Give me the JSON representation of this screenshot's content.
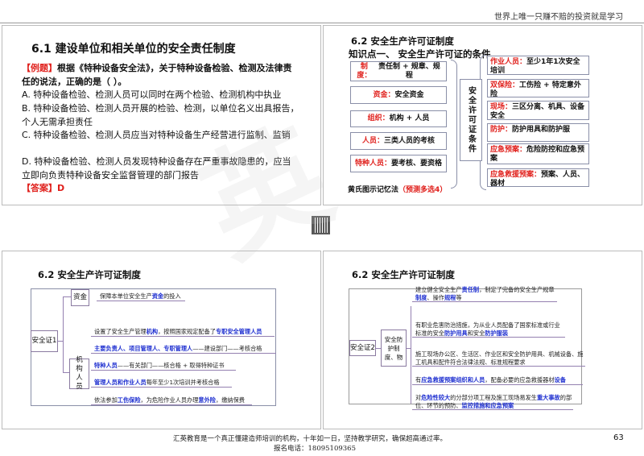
{
  "header": {
    "motto": "世界上唯一只赚不赔的投资就是学习"
  },
  "slide1": {
    "title": "6.1 建设单位和相关单位的安全责任制度",
    "question_tag": "【例题】",
    "question": "根据《特种设备安全法》，关于特种设备检验、检测及法律责任的说法，正确的是（ ）。",
    "options": [
      "A. 特种设备检验、检测人员可以同时在两个检验、检测机构中执业",
      "B. 特种设备检验、检测人员开展的检验、检测，以单位名义出具报告，个人无需承担责任",
      "C. 特种设备检验、检测人员应当对特种设备生产经营进行监制、监销",
      "D. 特种设备检验、检测人员发现特种设备存在严重事故隐患的，应当立即向负责特种设备安全监督管理的部门报告"
    ],
    "answer_tag": "【答案】",
    "answer": "D"
  },
  "slide2": {
    "title": "6.2 安全生产许可证制度",
    "subtitle": "知识点一、 安全生产许可证的条件",
    "center": "安全许可证条件",
    "left": [
      {
        "k": "制度：",
        "v": "责任制 + 规章、规程"
      },
      {
        "k": "资金：",
        "v": "安全资金"
      },
      {
        "k": "组织：",
        "v": "机构 + 人员"
      },
      {
        "k": "人员：",
        "v": "三类人员的考核"
      },
      {
        "k": "特种人员：",
        "v": "要考核、要资格"
      }
    ],
    "right": [
      {
        "k": "作业人员：",
        "v": "至少1年1次安全培训"
      },
      {
        "k": "双保险：",
        "v": "工伤险 + 特定意外险"
      },
      {
        "k": "现场：",
        "v": "三区分离、机具、设备安全"
      },
      {
        "k": "防护：",
        "v": "防护用具和防护服"
      },
      {
        "k": "应急预案：",
        "v": "危险防控和应急预案"
      },
      {
        "k": "应急救援预案：",
        "v": "预案、人员、器材"
      }
    ],
    "note": "黄氏图示记忆法",
    "note_red": "（预测多选4）"
  },
  "slide3": {
    "title": "6.2 安全生产许可证制度",
    "root": "安全证1",
    "node_fund": "资金",
    "node_org": "机构人员",
    "rows": [
      [
        {
          "t": "保障本单位安全生产"
        },
        {
          "t": "资金",
          "hl": true
        },
        {
          "t": "的投入"
        }
      ],
      [
        {
          "t": "设置了安全生产管理"
        },
        {
          "t": "机构",
          "hl": true
        },
        {
          "t": "，按照国家规定配备了"
        },
        {
          "t": "专职安全管理人员",
          "hl": true
        }
      ],
      [
        {
          "t": "主要负责人、项目管理人、专职管理人",
          "hl": true
        },
        {
          "t": "——建设部门——考核合格"
        }
      ],
      [
        {
          "t": "特种人员",
          "hl": true
        },
        {
          "t": "——有关部门——核合格 + 取得特种证书"
        }
      ],
      [
        {
          "t": "管理人员和作业人员",
          "hl": true
        },
        {
          "t": "每年至少1次培训并考核合格"
        }
      ],
      [
        {
          "t": "依法参加"
        },
        {
          "t": "工伤保险",
          "hl": true
        },
        {
          "t": "，为危险作业人员办理"
        },
        {
          "t": "意外险",
          "hl": true
        },
        {
          "t": "，缴纳保费"
        }
      ]
    ]
  },
  "slide4": {
    "title": "6.2 安全生产许可证制度",
    "root": "安全证2",
    "node": "安全防护制度、物",
    "rows": [
      [
        {
          "t": "建立健全安全生产"
        },
        {
          "t": "责任制",
          "hl": true
        },
        {
          "t": "，制定了完备的安全生产规章"
        },
        {
          "t": "制度",
          "hl": true
        },
        {
          "t": "、操作"
        },
        {
          "t": "规程",
          "hl": true
        },
        {
          "t": "等"
        }
      ],
      [
        {
          "t": "有职业危害防治措施，为从业人员配备了国家标准或行业标准的安全"
        },
        {
          "t": "防护用具",
          "hl": true
        },
        {
          "t": "和安全"
        },
        {
          "t": "防护服装",
          "hl": true
        }
      ],
      [
        {
          "t": "施工现场办公区、生活区、作业区和安全防护用具、机械设备、施工机具和配件符合法律法规、标准规程要求"
        }
      ],
      [
        {
          "t": "有"
        },
        {
          "t": "应急救援预案组织和人员",
          "hl": true
        },
        {
          "t": "，配备必要的应急救援器材"
        },
        {
          "t": "设备",
          "hl": true
        }
      ],
      [
        {
          "t": "对"
        },
        {
          "t": "危险性较大",
          "hl": true
        },
        {
          "t": "的分部分项工程及施工现场易发生"
        },
        {
          "t": "重大事故",
          "hl": true
        },
        {
          "t": "的部位、环节的预防、"
        },
        {
          "t": "监控措施和应急预案",
          "hl": true
        }
      ]
    ]
  },
  "footer": {
    "line1": "汇英教育是一个真正懂建造师培训的机构，十年如一日，坚持教学研究，确保超高通过率。",
    "line2": "报名电话：18095109365",
    "page": "63"
  }
}
